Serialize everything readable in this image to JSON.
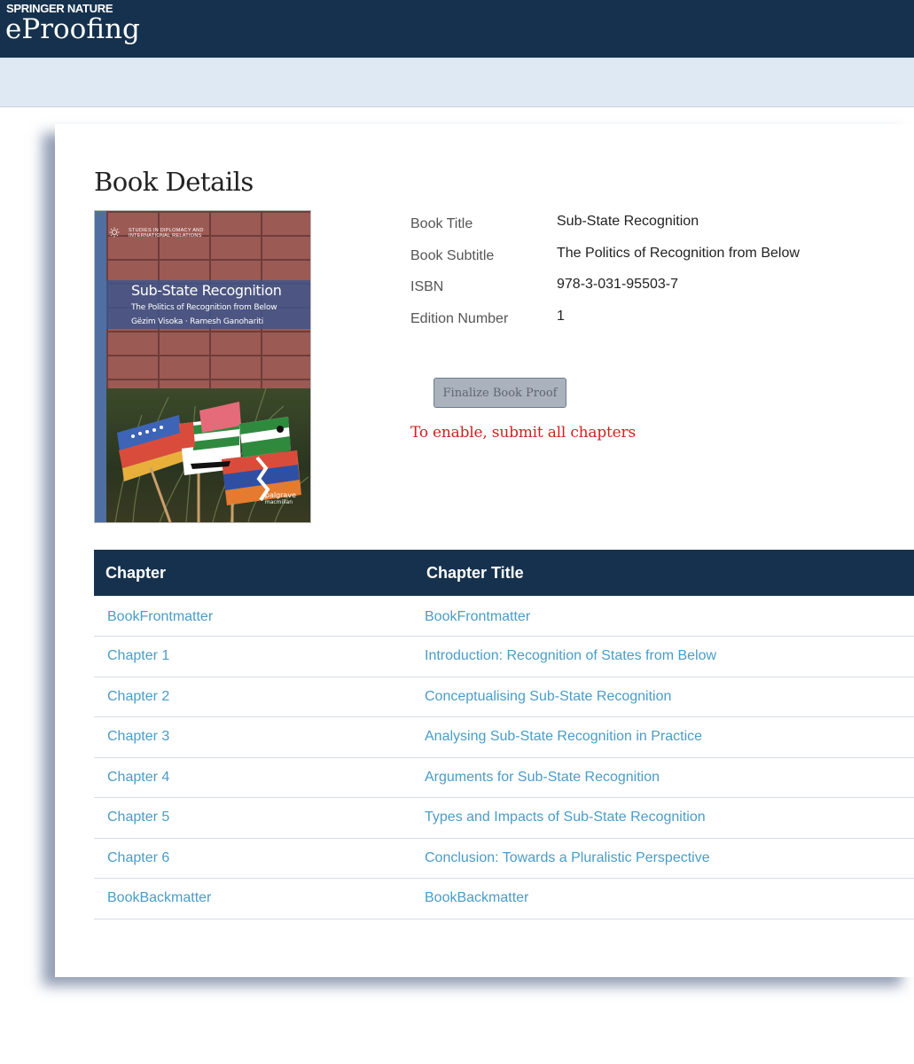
{
  "header": {
    "publisher": "Springer Nature",
    "app_name": "eProofing"
  },
  "page": {
    "title": "Book Details"
  },
  "cover": {
    "series": "Studies in Diplomacy and International Relations",
    "title": "Sub-State Recognition",
    "subtitle": "The Politics of Recognition from Below",
    "authors": "Gëzim Visoka · Ramesh Ganohariti",
    "publisher_logo": "palgrave",
    "publisher_logo_sub": "macmillan"
  },
  "details": [
    {
      "label": "Book Title",
      "value": "Sub-State Recognition"
    },
    {
      "label": "Book Subtitle",
      "value": "The Politics of Recognition from Below"
    },
    {
      "label": "ISBN",
      "value": "978-3-031-95503-7"
    },
    {
      "label": "Edition Number",
      "value": "1"
    }
  ],
  "actions": {
    "finalize_label": "Finalize Book Proof",
    "finalize_hint": "To enable, submit all chapters",
    "finalize_disabled": true
  },
  "table": {
    "headers": [
      "Chapter",
      "Chapter Title"
    ],
    "rows": [
      {
        "chapter": "BookFrontmatter",
        "title": "BookFrontmatter"
      },
      {
        "chapter": "Chapter 1",
        "title": "Introduction: Recognition of States from Below"
      },
      {
        "chapter": "Chapter 2",
        "title": "Conceptualising Sub-State Recognition"
      },
      {
        "chapter": "Chapter 3",
        "title": "Analysing Sub-State Recognition in Practice"
      },
      {
        "chapter": "Chapter 4",
        "title": "Arguments for Sub-State Recognition"
      },
      {
        "chapter": "Chapter 5",
        "title": "Types and Impacts of Sub-State Recognition"
      },
      {
        "chapter": "Chapter 6",
        "title": "Conclusion: Towards a Pluralistic Perspective"
      },
      {
        "chapter": "BookBackmatter",
        "title": "BookBackmatter"
      }
    ]
  },
  "colors": {
    "header_bg": "#15314d",
    "subbar_bg": "#dfe9f4",
    "link": "#4a9cc7",
    "hint": "#cc2222"
  }
}
